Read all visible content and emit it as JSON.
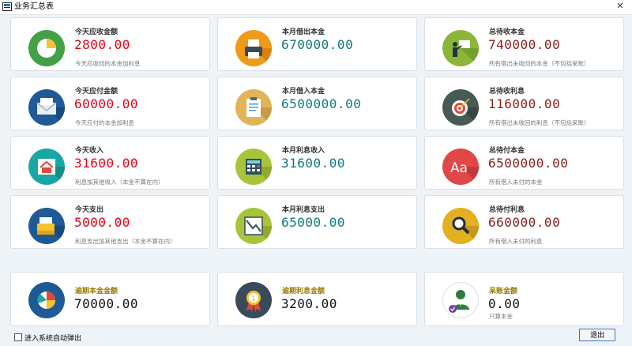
{
  "window": {
    "title": "业务汇总表",
    "close_label": "✕"
  },
  "cards": [
    {
      "label": "今天应收金额",
      "value": "2800.00",
      "desc": "今天应收回的本金加利息"
    },
    {
      "label": "本月借出本金",
      "value": "670000.00",
      "desc": ""
    },
    {
      "label": "总待收本金",
      "value": "740000.00",
      "desc": "所有借出未收回的本金（不包括呆账）"
    },
    {
      "label": "今天应付金额",
      "value": "60000.00",
      "desc": "今天应付的本金加利息"
    },
    {
      "label": "本月借入本金",
      "value": "6500000.00",
      "desc": ""
    },
    {
      "label": "总待收利息",
      "value": "116000.00",
      "desc": "所有借出未收回的利息（不包括呆账）"
    },
    {
      "label": "今天收入",
      "value": "31600.00",
      "desc": "利息加其他收入（本金不算在内）"
    },
    {
      "label": "本月利息收入",
      "value": "31600.00",
      "desc": ""
    },
    {
      "label": "总待付本金",
      "value": "6500000.00",
      "desc": "所有借入未付的本金"
    },
    {
      "label": "今天支出",
      "value": "5000.00",
      "desc": "利息支出加其他支出（本金不算在内）"
    },
    {
      "label": "本月利息支出",
      "value": "65000.00",
      "desc": ""
    },
    {
      "label": "总待付利息",
      "value": "660000.00",
      "desc": "所有借入未付的利息"
    }
  ],
  "bottom": [
    {
      "label": "逾期本金金额",
      "value": "70000.00",
      "desc": ""
    },
    {
      "label": "逾期利息金额",
      "value": "3200.00",
      "desc": ""
    },
    {
      "label": "呆账金额",
      "value": "0.00",
      "desc": "只算本金"
    }
  ],
  "footer": {
    "checkbox_label": "进入系统自动弹出",
    "exit_label": "退出"
  }
}
